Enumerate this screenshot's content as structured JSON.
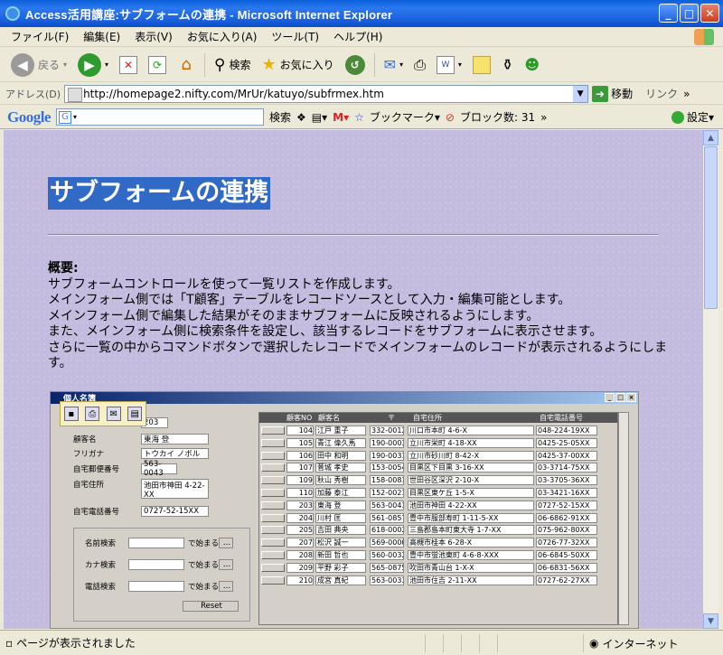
{
  "window": {
    "title": "Access活用講座:サブフォームの連携 - Microsoft Internet Explorer",
    "minimize": "_",
    "maximize": "□",
    "close": "✕"
  },
  "menu": [
    "ファイル(F)",
    "編集(E)",
    "表示(V)",
    "お気に入り(A)",
    "ツール(T)",
    "ヘルプ(H)"
  ],
  "toolbar": {
    "back": "戻る",
    "search": "検索",
    "favorites": "お気に入り"
  },
  "address": {
    "label": "アドレス(D)",
    "url": "http://homepage2.nifty.com/MrUr/katuyo/subfrmex.htm",
    "go": "移動",
    "links": "リンク"
  },
  "google": {
    "logo": "Google",
    "search": "検索",
    "bookmarks": "ブックマーク▾",
    "blocked": "ブロック数: 31",
    "settings": "設定▾"
  },
  "page": {
    "heading": "サブフォームの連携",
    "overview_title": "概要:",
    "overview_lines": [
      "サブフォームコントロールを使って一覧リストを作成します。",
      "メインフォーム側では「T顧客」テーブルをレコードソースとして入力・編集可能とします。",
      "メインフォーム側で編集した結果がそのままサブフォームに反映されるようにします。",
      "また、メインフォーム側に検索条件を設定し、該当するレコードをサブフォームに表示させます。",
      "さらに一覧の中からコマンドボタンで選択したレコードでメインフォームのレコードが表示されるようにします。"
    ]
  },
  "embedded": {
    "title": "個人名簿",
    "fields": [
      {
        "label": "顧客NO",
        "value": "203"
      },
      {
        "label": "顧客名",
        "value": "東海 登"
      },
      {
        "label": "フリガナ",
        "value": "トウカイ ノボル"
      },
      {
        "label": "自宅郵便番号",
        "value": "563-0043"
      },
      {
        "label": "自宅住所",
        "value": "池田市神田 4-22-XX"
      },
      {
        "label": "自宅電話番号",
        "value": "0727-52-15XX"
      }
    ],
    "search": [
      {
        "label": "名前検索",
        "suffix": "で始まる",
        "btn": "…"
      },
      {
        "label": "カナ検索",
        "suffix": "で始まる",
        "btn": "…"
      },
      {
        "label": "電話検索",
        "suffix": "で始まる",
        "btn": "…"
      }
    ],
    "reset": "Reset",
    "columns": [
      "顧客NO",
      "顧客名",
      "〒",
      "自宅住所",
      "自宅電話番号"
    ],
    "rows": [
      [
        "104",
        "江戸 重子",
        "332-0012",
        "川口市本町 4-6-X",
        "048-224-19XX"
      ],
      [
        "105",
        "青江 偉久馬",
        "190-0003",
        "立川市栄町 4-18-XX",
        "0425-25-05XX"
      ],
      [
        "106",
        "田中 和明",
        "190-0031",
        "立川市砂川町 8-42-X",
        "0425-37-00XX"
      ],
      [
        "107",
        "菅城 孝史",
        "153-0054",
        "目黒区下目黒 3-16-XX",
        "03-3714-75XX"
      ],
      [
        "109",
        "秋山 秀樹",
        "158-0081",
        "世田谷区深沢 2-10-X",
        "03-3705-36XX"
      ],
      [
        "110",
        "加藤 泰江",
        "152-0021",
        "目黒区東ケ丘 1-5-X",
        "03-3421-16XX"
      ],
      [
        "203",
        "東海 登",
        "563-0043",
        "池田市神田 4-22-XX",
        "0727-52-15XX"
      ],
      [
        "204",
        "川村 匡",
        "561-0857",
        "豊中市服部寿町 1-11-5-XX",
        "06-6862-91XX"
      ],
      [
        "205",
        "吉田 典央",
        "618-0002",
        "三島郡島本町東大寺 1-7-XX",
        "075-962-80XX"
      ],
      [
        "207",
        "松沢 誠一",
        "569-0000",
        "高槻市桂本 6-28-X",
        "0726-77-32XX"
      ],
      [
        "208",
        "新田 哲也",
        "560-0032",
        "豊中市蛍池東町 4-6-8-XXX",
        "06-6845-50XX"
      ],
      [
        "209",
        "平野 彩子",
        "565-0875",
        "吹田市青山台 1-X-X",
        "06-6831-56XX"
      ],
      [
        "210",
        "成宮 真紀",
        "563-0033",
        "池田市住吉 2-11-XX",
        "0727-62-27XX"
      ]
    ]
  },
  "status": {
    "text": "ページが表示されました",
    "zone": "インターネット"
  }
}
